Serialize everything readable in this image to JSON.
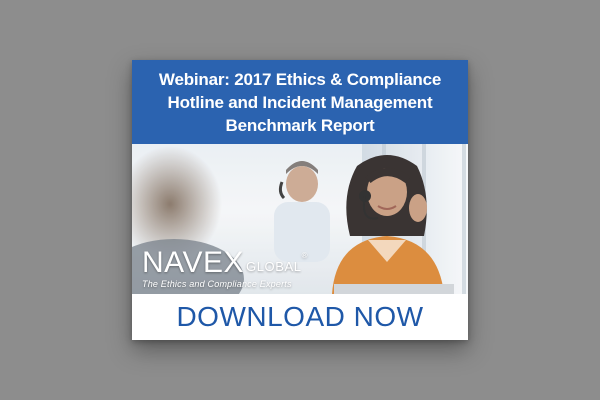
{
  "banner": {
    "title_lines": [
      "Webinar: 2017 Ethics & Compliance",
      "Hotline and Incident Management",
      "Benchmark Report"
    ],
    "logo": {
      "name": "NAVEX",
      "suffix": "GLOBAL",
      "mark": "®",
      "tagline": "The Ethics and Compliance Experts"
    },
    "cta_label": "DOWNLOAD NOW"
  },
  "colors": {
    "page_background": "#8d8d8d",
    "header_blue": "#2b63b0",
    "cta_text": "#1f58a8"
  }
}
